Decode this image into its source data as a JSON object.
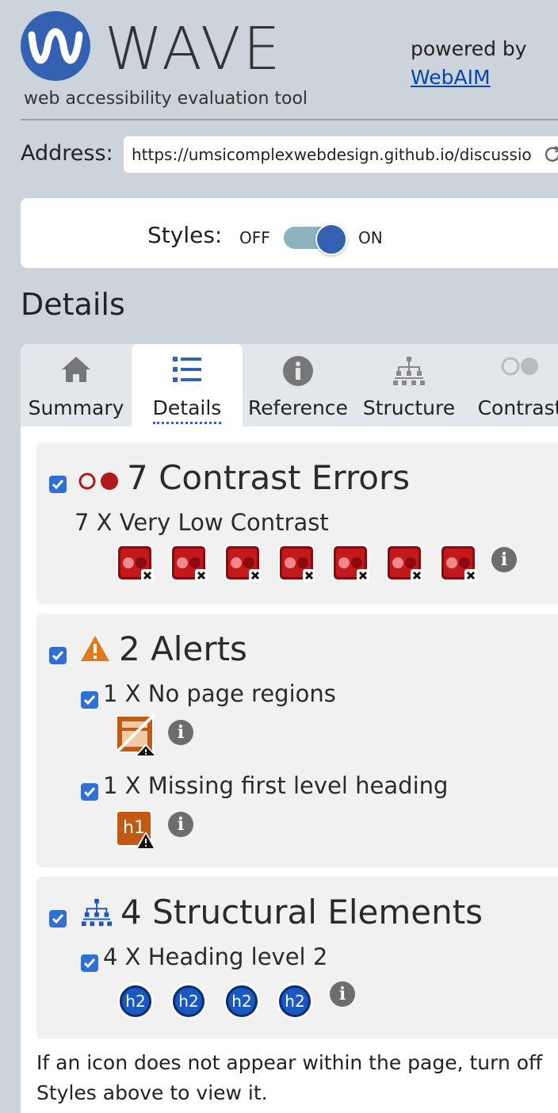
{
  "header": {
    "title": "WAVE",
    "subtitle": "web accessibility evaluation tool",
    "powered_by": "powered by",
    "webaim_link": "WebAIM"
  },
  "address": {
    "label": "Address:",
    "value": "https://umsicomplexwebdesign.github.io/discussio"
  },
  "styles": {
    "label": "Styles:",
    "off": "OFF",
    "on": "ON",
    "state": "on"
  },
  "details_heading": "Details",
  "tabs": [
    {
      "label": "Summary",
      "icon": "home-icon"
    },
    {
      "label": "Details",
      "icon": "list-icon",
      "active": true
    },
    {
      "label": "Reference",
      "icon": "info-icon"
    },
    {
      "label": "Structure",
      "icon": "structure-icon"
    },
    {
      "label": "Contrast",
      "icon": "contrast-icon"
    }
  ],
  "contrast": {
    "title": "7 Contrast Errors",
    "item_text": "7 X Very Low Contrast",
    "count": 7
  },
  "alerts": {
    "title": "2 Alerts",
    "items": [
      {
        "text": "1 X No page regions",
        "icon": "no-regions-alert-icon"
      },
      {
        "text": "1 X Missing first level heading",
        "icon": "h1-missing-alert-icon",
        "icon_text": "h1"
      }
    ]
  },
  "structure": {
    "title": "4 Structural Elements",
    "item_text": "4 X Heading level 2",
    "icon_text": "h2",
    "count": 4
  },
  "footnote": "If an icon does not appear within the page, turn off Styles above to view it.",
  "colors": {
    "accent": "#3461b1",
    "error": "#b1181c",
    "alert": "#e07b1c",
    "structure": "#1a59c4"
  }
}
